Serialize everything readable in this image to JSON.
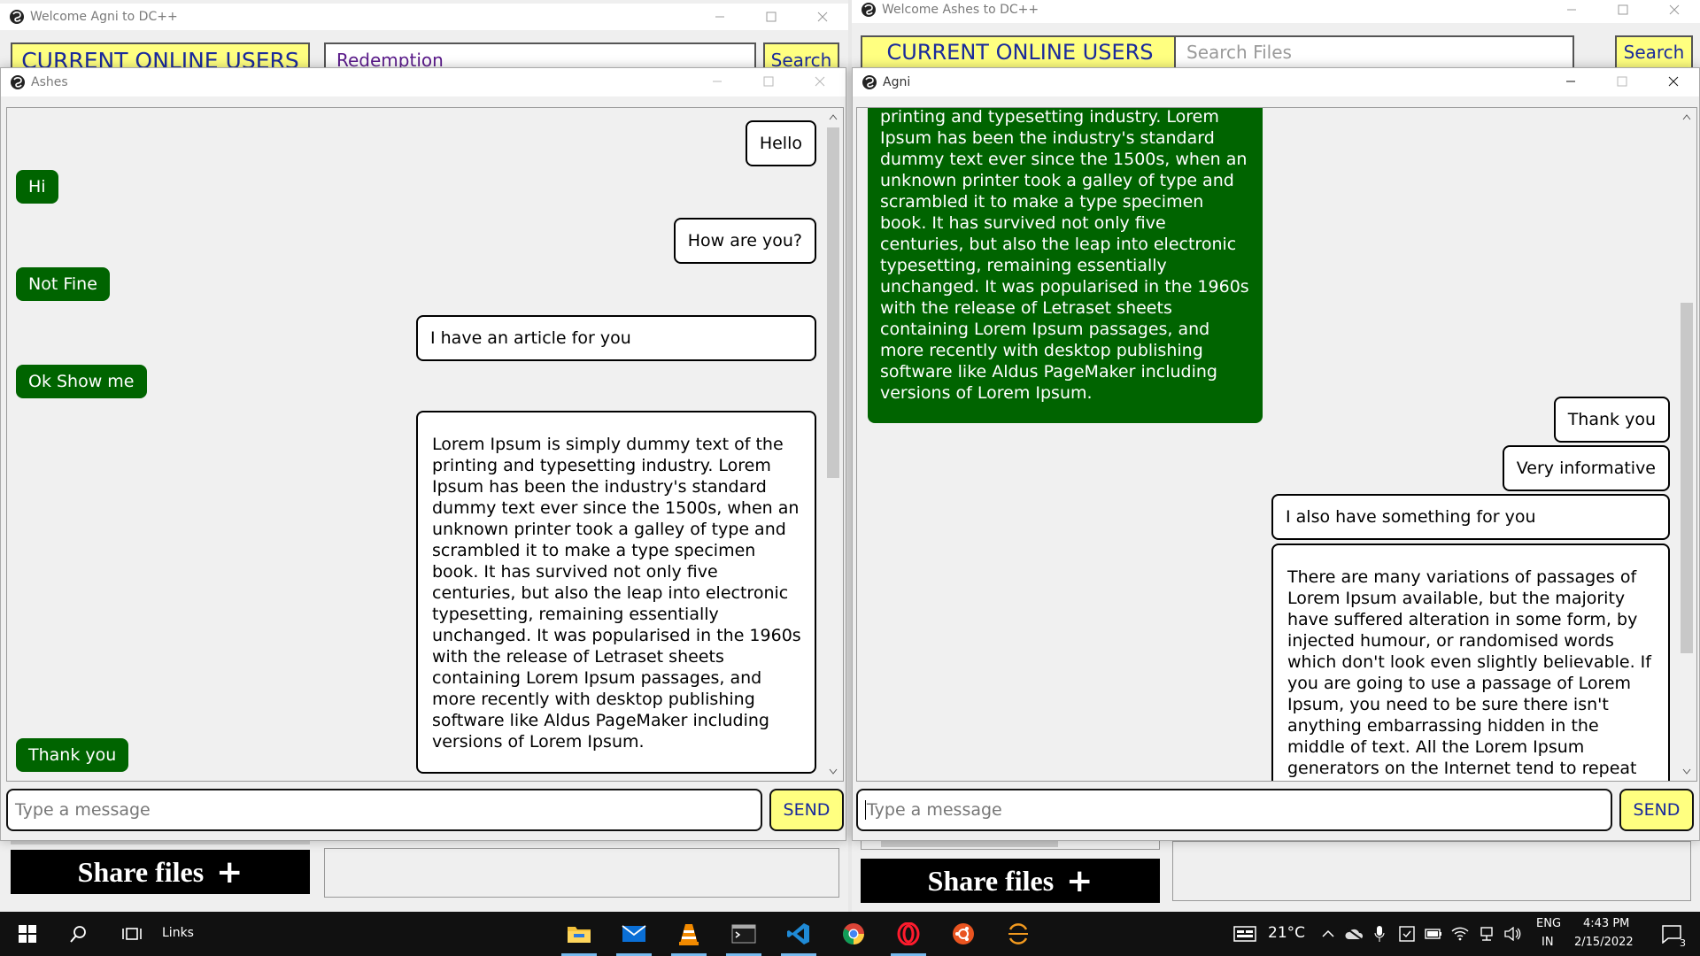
{
  "colors": {
    "received_bubble": "#006400",
    "sent_bubble_border": "#000000",
    "accent_yellow": "#ffff80",
    "accent_text": "#1a2a9c",
    "taskbar": "#111111"
  },
  "left_main": {
    "title": "Welcome Agni to DC++",
    "online_users_tab": "CURRENT ONLINE USERS",
    "search_value": "Redemption",
    "search_button": "Search",
    "share_button": "Share files"
  },
  "right_main": {
    "title": "Welcome Ashes to DC++",
    "online_users_tab": "CURRENT ONLINE USERS",
    "search_placeholder": "Search Files",
    "search_button": "Search",
    "share_button": "Share files"
  },
  "chat_left": {
    "title": "Ashes",
    "input_placeholder": "Type a message",
    "send_label": "SEND",
    "messages": [
      {
        "dir": "sent",
        "text": "Hello"
      },
      {
        "dir": "recv",
        "text": "Hi"
      },
      {
        "dir": "sent",
        "text": "How are you?"
      },
      {
        "dir": "recv",
        "text": "Not Fine"
      },
      {
        "dir": "sent",
        "text": "I have an article for you"
      },
      {
        "dir": "recv",
        "text": "Ok Show me"
      },
      {
        "dir": "sent",
        "text": "Lorem Ipsum is simply dummy text of the printing and typesetting industry. Lorem Ipsum has been the industry's standard dummy text ever since the 1500s, when an unknown printer took a galley of type and scrambled it to make a type specimen book. It has survived not only five centuries, but also the leap into electronic typesetting, remaining essentially unchanged. It was popularised in the 1960s with the release of Letraset sheets containing Lorem Ipsum passages, and more recently with desktop publishing software like Aldus PageMaker including versions of Lorem Ipsum."
      },
      {
        "dir": "recv",
        "text": "Thank you"
      }
    ]
  },
  "chat_right": {
    "title": "Agni",
    "input_placeholder": "Type a message",
    "send_label": "SEND",
    "messages": [
      {
        "dir": "recv",
        "text": "Lorem Ipsum is simply dummy text of the printing and typesetting industry. Lorem Ipsum has been the industry's standard dummy text ever since the 1500s, when an unknown printer took a galley of type and scrambled it to make a type specimen book. It has survived not only five centuries, but also the leap into electronic typesetting, remaining essentially unchanged. It was popularised in the 1960s with the release of Letraset sheets containing Lorem Ipsum passages, and more recently with desktop publishing software like Aldus PageMaker including versions of Lorem Ipsum."
      },
      {
        "dir": "sent",
        "text": "Thank you"
      },
      {
        "dir": "sent",
        "text": "Very informative"
      },
      {
        "dir": "sent",
        "text": "I also have something for you"
      },
      {
        "dir": "sent",
        "text": "There are many variations of passages of Lorem Ipsum available, but the majority have suffered alteration in some form, by injected humour, or randomised words which don't look even slightly believable. If you are going to use a passage of Lorem Ipsum, you need to be sure there isn't anything embarrassing hidden in the middle of text. All the Lorem Ipsum generators on the Internet tend to repeat predefined chunks as necessary, making this"
      }
    ]
  },
  "taskbar": {
    "links_label": "Links",
    "weather": "21°C",
    "lang_top": "ENG",
    "lang_bottom": "IN",
    "time": "4:43 PM",
    "date": "2/15/2022",
    "notification_count": "3",
    "apps": [
      "file-explorer",
      "mail",
      "vlc",
      "terminal",
      "vscode",
      "chrome",
      "opera",
      "ubuntu",
      "eclipse"
    ]
  }
}
